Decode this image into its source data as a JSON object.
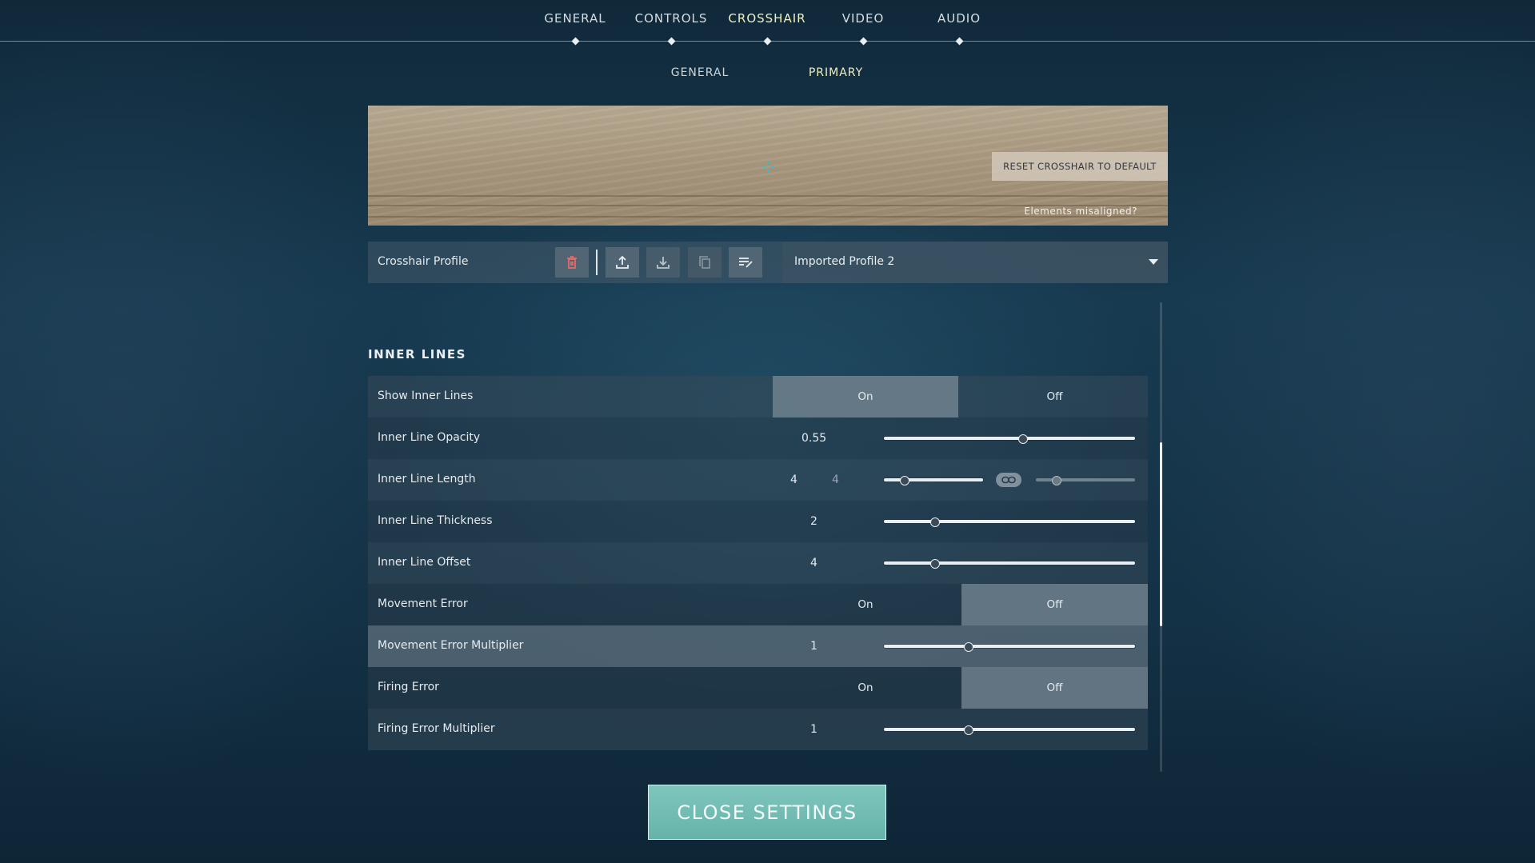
{
  "nav": {
    "tabs": [
      {
        "label": "GENERAL"
      },
      {
        "label": "CONTROLS"
      },
      {
        "label": "CROSSHAIR"
      },
      {
        "label": "VIDEO"
      },
      {
        "label": "AUDIO"
      }
    ],
    "active_tab": "CROSSHAIR",
    "subtabs": [
      {
        "label": "GENERAL"
      },
      {
        "label": "PRIMARY"
      }
    ],
    "active_subtab": "PRIMARY"
  },
  "preview": {
    "reset_label": "RESET CROSSHAIR TO DEFAULT",
    "misaligned_label": "Elements misaligned?"
  },
  "profile": {
    "label": "Crosshair Profile",
    "selected": "Imported Profile 2",
    "icons": [
      "delete-icon",
      "export-icon",
      "import-icon",
      "copy-icon",
      "rename-icon"
    ]
  },
  "section": {
    "title": "INNER LINES",
    "rows": [
      {
        "label": "Show Inner Lines",
        "on": "On",
        "off": "Off",
        "selected": "On"
      },
      {
        "label": "Inner Line Opacity",
        "value": "0.55",
        "fraction": 0.55
      },
      {
        "label": "Inner Line Length",
        "value": "4",
        "value2": "4",
        "fraction": 0.2,
        "fraction2": 0.2
      },
      {
        "label": "Inner Line Thickness",
        "value": "2",
        "fraction": 0.2
      },
      {
        "label": "Inner Line Offset",
        "value": "4",
        "fraction": 0.2
      },
      {
        "label": "Movement Error",
        "on": "On",
        "off": "Off",
        "selected": "Off"
      },
      {
        "label": "Movement Error Multiplier",
        "value": "1",
        "fraction": 0.333
      },
      {
        "label": "Firing Error",
        "on": "On",
        "off": "Off",
        "selected": "Off"
      },
      {
        "label": "Firing Error Multiplier",
        "value": "1",
        "fraction": 0.333
      }
    ]
  },
  "close_button": "CLOSE SETTINGS",
  "colors": {
    "accent_yellow": "#f0efc0",
    "close_teal": "#6fbcb3",
    "delete_red": "#e46b6b"
  }
}
